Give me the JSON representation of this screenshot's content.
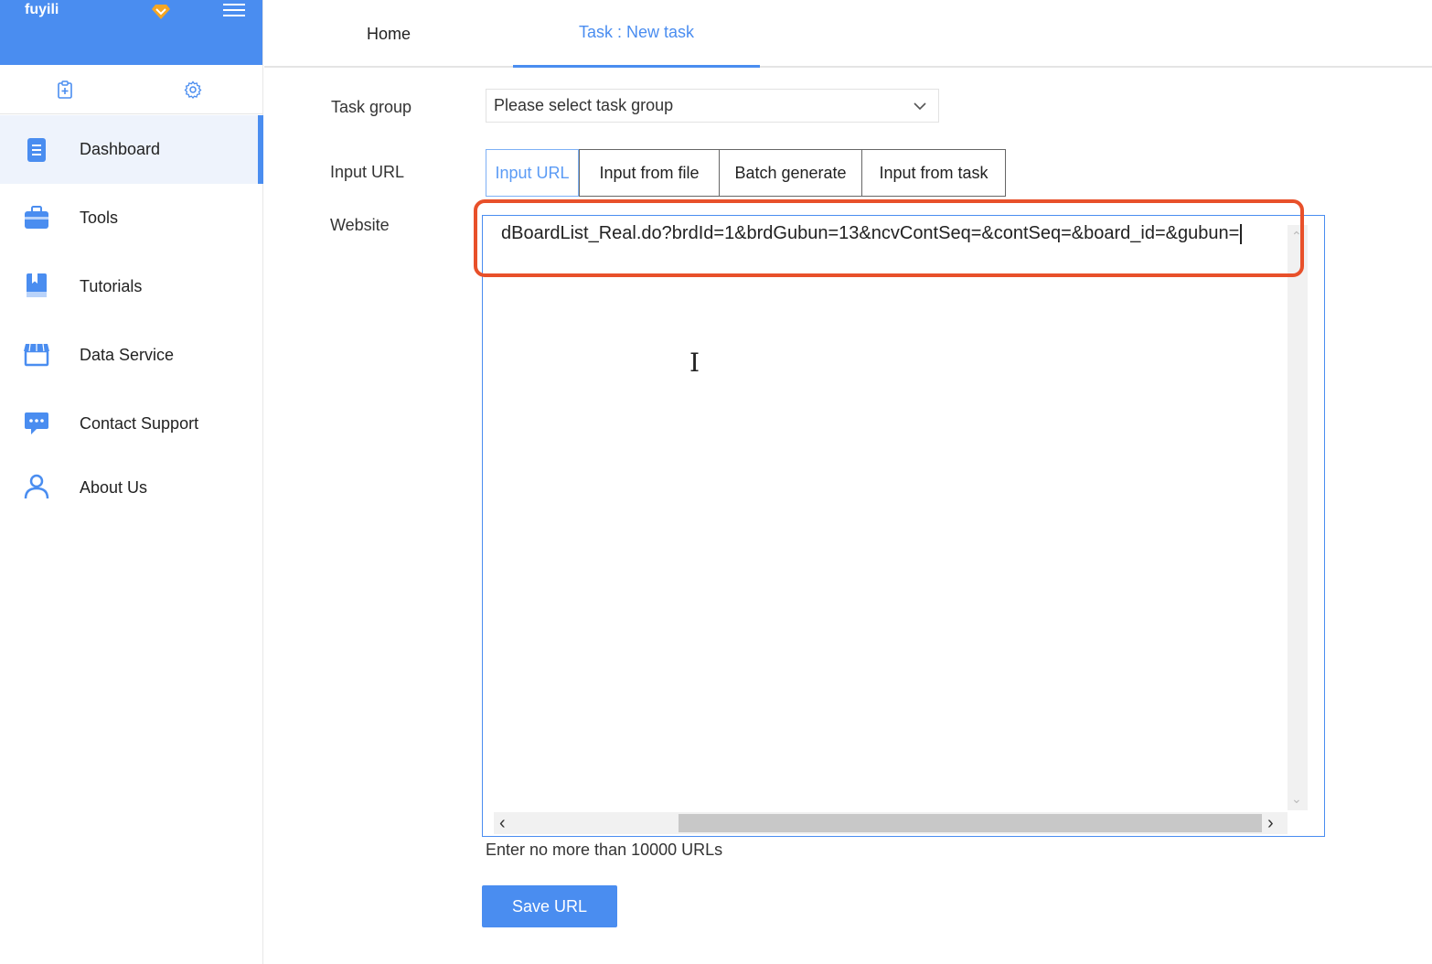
{
  "app": {
    "brand": "fuyili",
    "accent_color": "#4a8df0",
    "highlight_color": "#e8502a"
  },
  "sidebar": {
    "top_icons": [
      "clipboard-add-icon",
      "settings-gear-icon"
    ],
    "items": [
      {
        "label": "Dashboard",
        "icon": "document-icon",
        "active": true
      },
      {
        "label": "Tools",
        "icon": "toolbox-icon",
        "active": false
      },
      {
        "label": "Tutorials",
        "icon": "book-icon",
        "active": false
      },
      {
        "label": "Data Service",
        "icon": "store-icon",
        "active": false
      },
      {
        "label": "Contact Support",
        "icon": "chat-bubble-icon",
        "active": false
      },
      {
        "label": "About Us",
        "icon": "user-icon",
        "active": false
      }
    ]
  },
  "tabs": {
    "home": "Home",
    "task": "Task : New task"
  },
  "form": {
    "task_group_label": "Task group",
    "task_group_value": "Please select task group",
    "input_url_label": "Input URL",
    "website_label": "Website",
    "modes": [
      "Input URL",
      "Input from file",
      "Batch generate",
      "Input from task"
    ],
    "selected_mode": "Input URL",
    "url_value": "dBoardList_Real.do?brdId=1&brdGubun=13&ncvContSeq=&contSeq=&board_id=&gubun=",
    "hint": "Enter no more than 10000 URLs",
    "save_label": "Save URL"
  }
}
